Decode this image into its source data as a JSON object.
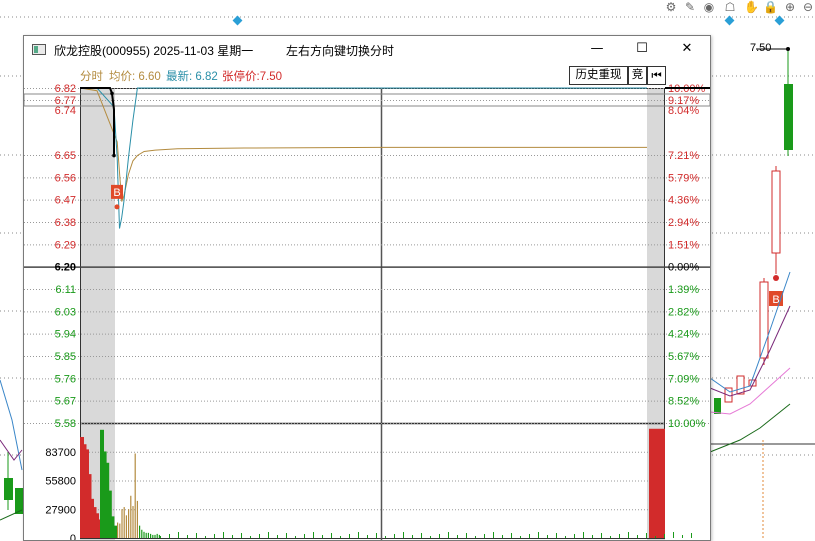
{
  "window": {
    "title": "欣龙控股(000955) 2025-11-03 星期一",
    "hint": "左右方向键切换分时",
    "minimize_icon": "minimize-icon",
    "maximize_icon": "maximize-icon",
    "close_icon": "close-icon"
  },
  "legend": {
    "tab": "分时",
    "avg_label": "均价: 6.60",
    "latest_label": "最新: 6.82",
    "limit_label": "张停价:7.50"
  },
  "buttons": {
    "history_replay": "历史重现",
    "bid": "竞",
    "back_icon": "back-icon"
  },
  "toolbar": {
    "icons": [
      "settings-icon",
      "pen-icon",
      "eye-icon",
      "basket-icon",
      "hand-icon",
      "lock-icon",
      "zoom-in-icon",
      "zoom-out-icon"
    ]
  },
  "background_chart": {
    "price_label": "7.50",
    "buy_marker": "B"
  },
  "colors": {
    "up": "#d22b2b",
    "down": "#1a9a1a",
    "price_line": "#2a8fa8",
    "avg_line": "#b38b3f",
    "neutral": "#000000"
  },
  "chart_data": {
    "type": "line",
    "title": "",
    "prev_close": 6.2,
    "y_ticks_left": [
      "6.82",
      "6.77",
      "6.74",
      "6.65",
      "6.56",
      "6.47",
      "6.38",
      "6.29",
      "6.20",
      "6.11",
      "6.03",
      "5.94",
      "5.85",
      "5.76",
      "5.67",
      "5.58"
    ],
    "y_ticks_right": [
      "10.00%",
      "9.17%",
      "8.04%",
      "7.21%",
      "5.79%",
      "4.36%",
      "2.94%",
      "1.51%",
      "0.00%",
      "1.39%",
      "2.82%",
      "4.24%",
      "5.67%",
      "7.09%",
      "8.52%",
      "10.00%"
    ],
    "ylim": [
      5.58,
      6.82
    ],
    "volume_ticks": [
      "83700",
      "55800",
      "27900",
      "0"
    ],
    "volume_max": 111600,
    "series": [
      {
        "name": "最新",
        "x": [
          0,
          1,
          2,
          3,
          4,
          5,
          6,
          8,
          10,
          12,
          15,
          20,
          30,
          60,
          120,
          240
        ],
        "values": [
          6.82,
          6.82,
          6.75,
          6.56,
          6.3,
          6.34,
          6.4,
          6.56,
          6.7,
          6.82,
          6.82,
          6.82,
          6.82,
          6.82,
          6.82,
          6.82
        ]
      },
      {
        "name": "均价",
        "x": [
          0,
          1,
          3,
          5,
          6,
          8,
          10,
          12,
          15,
          20,
          30,
          60,
          120,
          180,
          240
        ],
        "values": [
          6.82,
          6.81,
          6.62,
          6.4,
          6.42,
          6.5,
          6.55,
          6.57,
          6.585,
          6.59,
          6.595,
          6.598,
          6.6,
          6.6,
          6.6
        ]
      }
    ],
    "buy_marker": {
      "label": "B",
      "x": 2,
      "y": 6.38
    },
    "volume_bars_up": [
      98000,
      91000,
      86000,
      62000,
      38000,
      30000,
      24000,
      18000
    ],
    "volume_bars_down": [
      105000,
      84000,
      73000,
      46000,
      21000,
      12000
    ],
    "volume_bars_light": [
      15000,
      14000,
      28000,
      30000,
      22000,
      28000,
      41000,
      31000,
      82000,
      36000,
      12000,
      8000,
      6000,
      5000,
      5000,
      4000,
      3000,
      3000,
      4000,
      3000
    ]
  }
}
